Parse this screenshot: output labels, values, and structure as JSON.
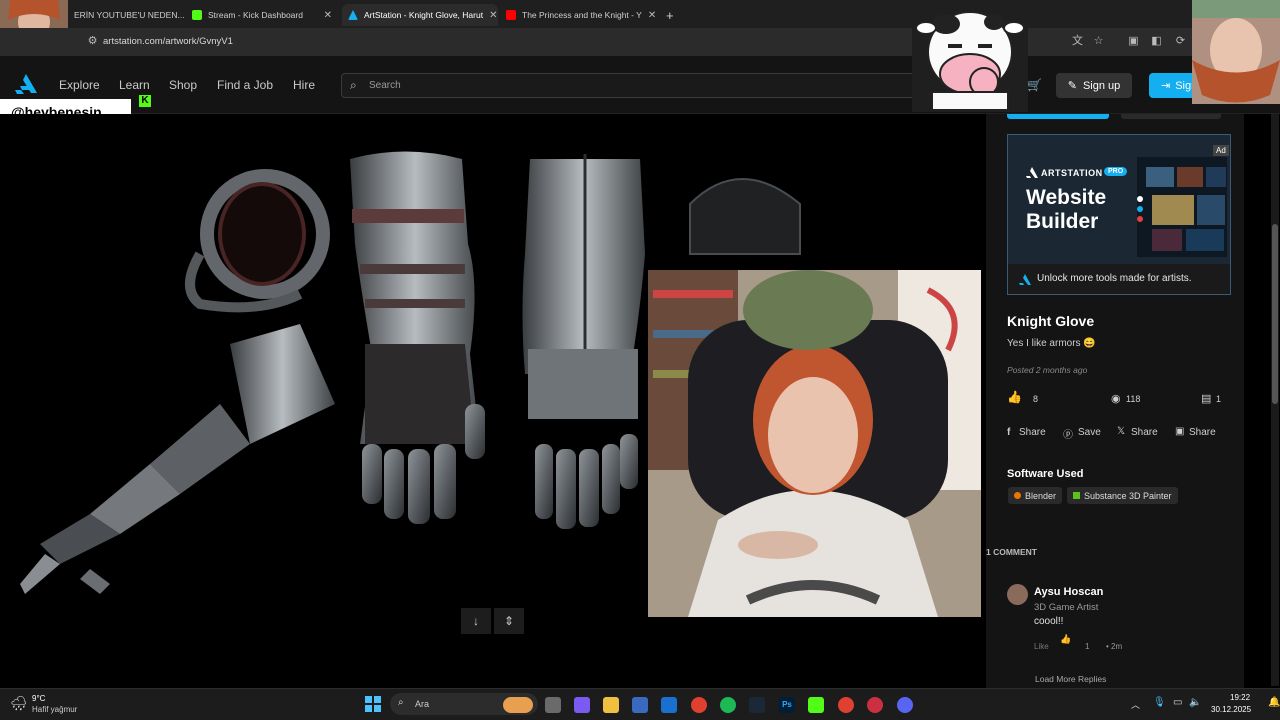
{
  "tabs": [
    {
      "label": "ERİN YOUTUBE'U NEDEN...",
      "favicon_color": "#c4302b"
    },
    {
      "label": "Stream - Kick Dashboard",
      "favicon_color": "#53fc18"
    },
    {
      "label": "ArtStation - Knight Glove, Harut",
      "favicon_color": "#13aff0"
    },
    {
      "label": "The Princess and the Knight - Y",
      "favicon_color": "#ff0000"
    }
  ],
  "url": "artstation.com/artwork/GvnyV1",
  "nav": {
    "items": [
      "Explore",
      "Learn",
      "Shop",
      "Find a Job",
      "Hire"
    ],
    "search_placeholder": "Search",
    "signup_label": "Sign up",
    "signin_label": "Sign"
  },
  "overlay_handle": "@heybenesin",
  "ad": {
    "brand": "ARTSTATION",
    "pro_badge": "PRO",
    "title_line1": "Website",
    "title_line2": "Builder",
    "ad_badge": "Ad",
    "footer": "Unlock more tools made for artists."
  },
  "artwork": {
    "title": "Knight Glove",
    "description": "Yes I like armors 😄",
    "posted": "Posted 2 months ago",
    "likes": "8",
    "views": "118",
    "comments_count": "1",
    "share_labels": [
      "Share",
      "Save",
      "Share",
      "Share"
    ]
  },
  "software": {
    "heading": "Software Used",
    "items": [
      "Blender",
      "Substance 3D Painter"
    ]
  },
  "comments": {
    "heading": "1 COMMENT",
    "author": "Aysu Hoscan",
    "role": "3D Game Artist",
    "text": "coool!!",
    "like_label": "Like",
    "like_count": "1",
    "time": "• 2m",
    "load_more": "Load More Replies"
  },
  "taskbar": {
    "weather_temp": "9°C",
    "weather_desc": "Hafif yağmur",
    "search_placeholder": "Ara",
    "time": "19:22",
    "date": "30.12.2025"
  },
  "colors": {
    "accent": "#13aff0",
    "header_bg": "#141414",
    "page_bg": "#000000"
  }
}
